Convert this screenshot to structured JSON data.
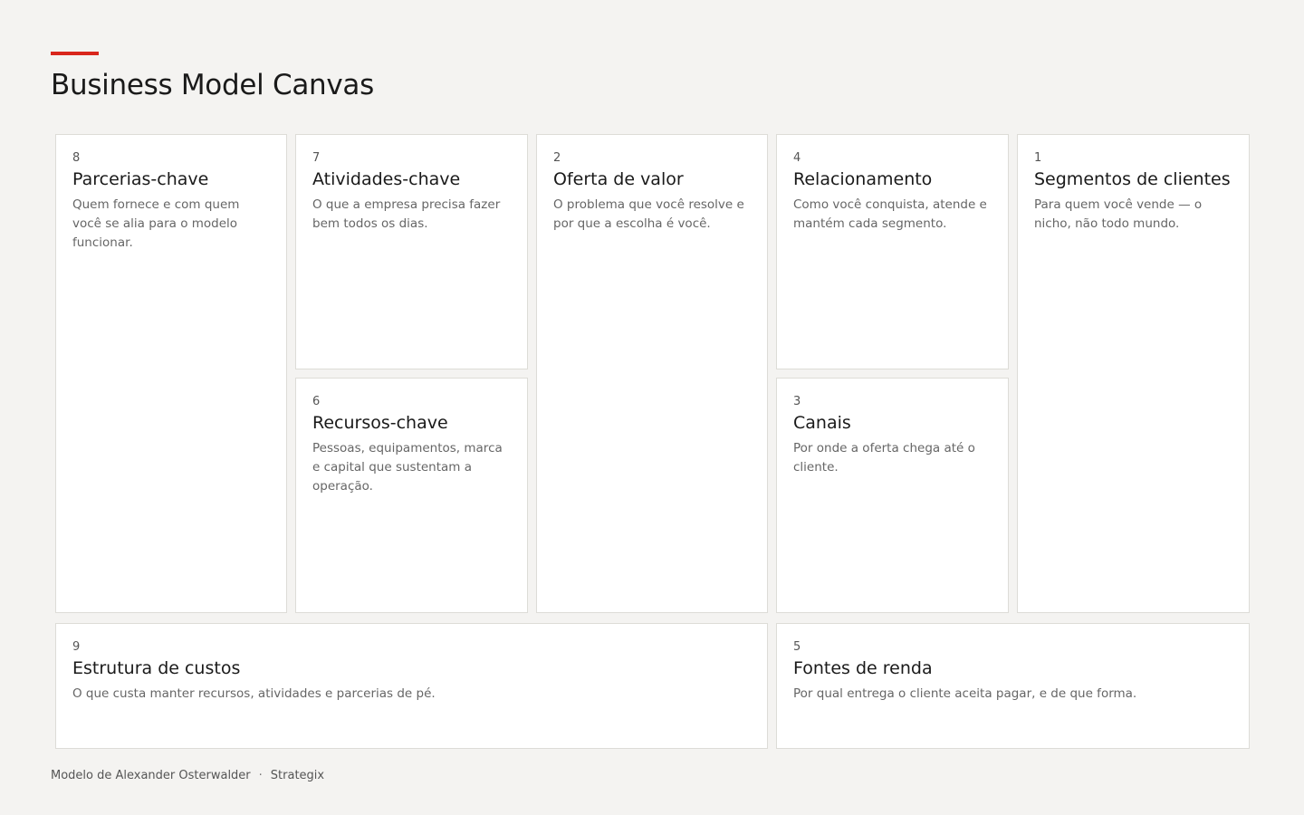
{
  "header": {
    "title": "Business Model Canvas"
  },
  "blocks": {
    "key_partners": {
      "number": "8",
      "title": "Parcerias-chave",
      "description": "Quem fornece e com quem você se alia para o modelo funcionar."
    },
    "key_activities": {
      "number": "7",
      "title": "Atividades-chave",
      "description": "O que a empresa precisa fazer bem todos os dias."
    },
    "key_resources": {
      "number": "6",
      "title": "Recursos-chave",
      "description": "Pessoas, equipamentos, marca e capital que sustentam a operação."
    },
    "value_proposition": {
      "number": "2",
      "title": "Oferta de valor",
      "description": "O problema que você resolve e por que a escolha é você."
    },
    "customer_relationships": {
      "number": "4",
      "title": "Relacionamento",
      "description": "Como você conquista, atende e mantém cada segmento."
    },
    "channels": {
      "number": "3",
      "title": "Canais",
      "description": "Por onde a oferta chega até o cliente."
    },
    "customer_segments": {
      "number": "1",
      "title": "Segmentos de clientes",
      "description": "Para quem você vende — o nicho, não todo mundo."
    },
    "cost_structure": {
      "number": "9",
      "title": "Estrutura de custos",
      "description": "O que custa manter recursos, atividades e parcerias de pé."
    },
    "revenue_streams": {
      "number": "5",
      "title": "Fontes de renda",
      "description": "Por qual entrega o cliente aceita pagar, e de que forma."
    }
  },
  "footer": {
    "credit": "Modelo de Alexander Osterwalder",
    "separator": "·",
    "brand": "Strategix"
  },
  "colors": {
    "accent": "#d9261c",
    "background": "#f4f3f1",
    "card": "#ffffff",
    "border": "#dddcd7"
  }
}
